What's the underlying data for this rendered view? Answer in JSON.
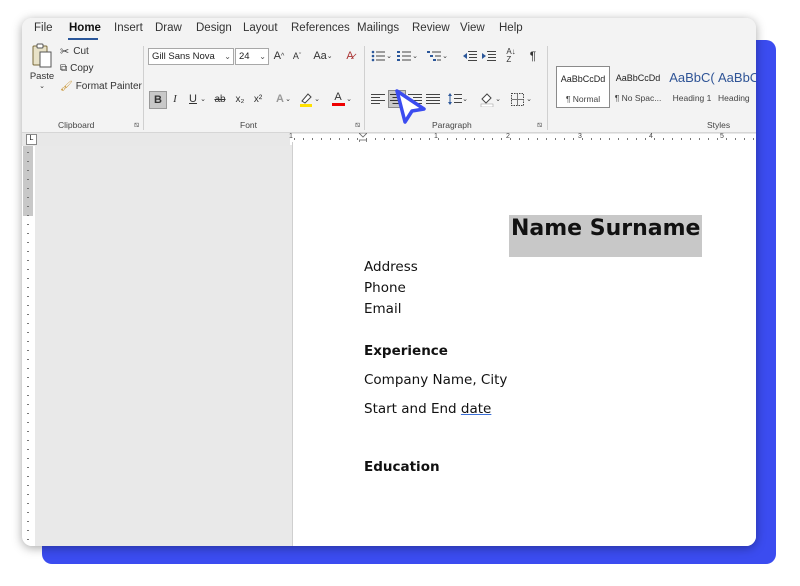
{
  "menu": [
    "File",
    "Home",
    "Insert",
    "Draw",
    "Design",
    "Layout",
    "References",
    "Mailings",
    "Review",
    "View",
    "Help"
  ],
  "clipboard": {
    "paste": "Paste",
    "cut": "Cut",
    "copy": "Copy",
    "format_painter": "Format Painter",
    "label": "Clipboard"
  },
  "font": {
    "name": "Gill Sans Nova",
    "size": "24",
    "label": "Font",
    "case": "Aa",
    "bold": "B",
    "italic": "I",
    "underline": "U",
    "strike": "ab",
    "sub": "x₂",
    "sup": "x²",
    "grow": "A",
    "shrink": "A"
  },
  "paragraph": {
    "label": "Paragraph",
    "pilcrow": "¶"
  },
  "styles": {
    "label": "Styles",
    "items": [
      {
        "sample": "AaBbCcDd",
        "name": "¶ Normal"
      },
      {
        "sample": "AaBbCcDd",
        "name": "¶ No Spac..."
      },
      {
        "sample": "AaBbC(",
        "name": "Heading 1"
      },
      {
        "sample": "AaBbC(",
        "name": "Heading"
      }
    ]
  },
  "ruler": {
    "numbers": [
      "1",
      "1",
      "2",
      "3",
      "4",
      "5"
    ]
  },
  "document": {
    "name": "Name Surname",
    "address": "Address",
    "phone": "Phone",
    "email": "Email",
    "experience": "Experience",
    "company": "Company Name, City",
    "dates_prefix": "Start and End ",
    "dates_suffix": "date",
    "education": "Education"
  },
  "colors": {
    "accent": "#2b579a",
    "cursor": "#3b4cf0",
    "highlight": "#c8c8c8"
  }
}
